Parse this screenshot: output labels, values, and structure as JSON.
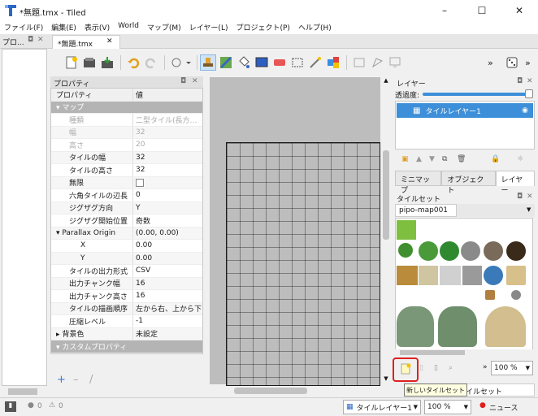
{
  "window": {
    "title": "*無題.tmx - Tiled",
    "minimize": "–",
    "maximize": "☐",
    "close": "✕"
  },
  "menu": [
    "ファイル(F)",
    "編集(E)",
    "表示(V)",
    "World",
    "マップ(M)",
    "レイヤー(L)",
    "プロジェクト(P)",
    "ヘルプ(H)"
  ],
  "left_dock": {
    "tab": "プロ...",
    "float_icon": "◘",
    "close_icon": "✕"
  },
  "doc_tab": {
    "label": "*無題.tmx",
    "close": "✕"
  },
  "toolbar": {
    "more": "»",
    "more2": "»"
  },
  "properties": {
    "title": "プロパティ",
    "col_name": "プロパティ",
    "col_value": "値",
    "rows": [
      {
        "k": "マップ",
        "v": "",
        "type": "group"
      },
      {
        "k": "種類",
        "v": "二型タイル(長方…",
        "type": "dim"
      },
      {
        "k": "幅",
        "v": "32",
        "type": "dim"
      },
      {
        "k": "高さ",
        "v": "20",
        "type": "dim"
      },
      {
        "k": "タイルの幅",
        "v": "32",
        "type": "normal"
      },
      {
        "k": "タイルの高さ",
        "v": "32",
        "type": "normal"
      },
      {
        "k": "無限",
        "v": "",
        "type": "check"
      },
      {
        "k": "六角タイルの辺長",
        "v": "0",
        "type": "normal"
      },
      {
        "k": "ジグザグ方向",
        "v": "Y",
        "type": "normal"
      },
      {
        "k": "ジグザグ開始位置",
        "v": "奇数",
        "type": "normal"
      },
      {
        "k": "Parallax Origin",
        "v": "(0.00, 0.00)",
        "type": "sub"
      },
      {
        "k": "X",
        "v": "0.00",
        "type": "indent"
      },
      {
        "k": "Y",
        "v": "0.00",
        "type": "indent"
      },
      {
        "k": "タイルの出力形式",
        "v": "CSV",
        "type": "normal"
      },
      {
        "k": "出力チャンク幅",
        "v": "16",
        "type": "normal"
      },
      {
        "k": "出力チャンク高さ",
        "v": "16",
        "type": "normal"
      },
      {
        "k": "タイルの描画順序",
        "v": "左から右、上から下",
        "type": "normal"
      },
      {
        "k": "圧縮レベル",
        "v": "-1",
        "type": "normal"
      },
      {
        "k": "背景色",
        "v": "未設定",
        "type": "collapsed"
      },
      {
        "k": "カスタムプロパティ",
        "v": "",
        "type": "group"
      }
    ],
    "add": "+",
    "remove": "–",
    "edit": "/"
  },
  "layers": {
    "title": "レイヤー",
    "opacity_label": "透過度:",
    "opacity": 1.0,
    "items": [
      {
        "name": "タイルレイヤー1"
      }
    ],
    "tabs": [
      "ミニマップ",
      "オブジェクト",
      "レイヤー"
    ]
  },
  "tilesets": {
    "title": "タイルセット",
    "current": "pipo-map001",
    "zoom": "100 %",
    "bottom_tab": "イルセット",
    "tooltip": "新しいタイルセット"
  },
  "statusbar": {
    "errors": "0",
    "warnings": "0",
    "layer": "タイルレイヤー1",
    "zoom": "100 %",
    "news": "ニュース"
  },
  "colors": {
    "accent": "#3c8fd8",
    "highlight": "#e02020",
    "group": "#b4b4b4"
  }
}
